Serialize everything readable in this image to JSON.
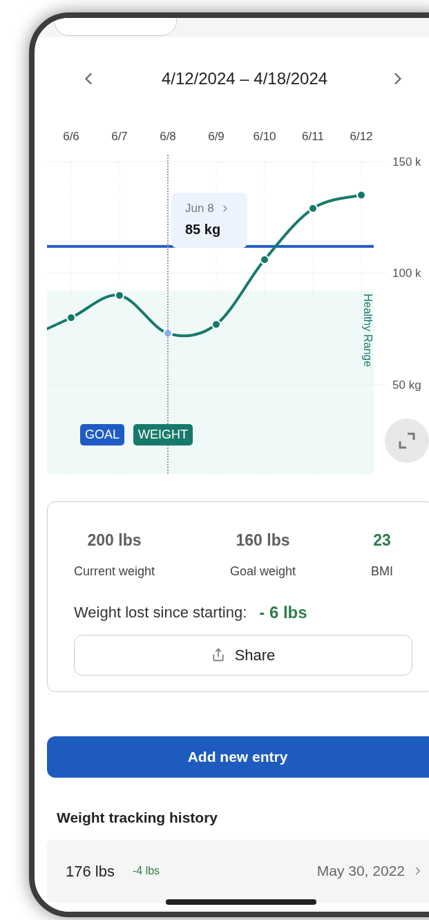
{
  "date_range": {
    "label": "4/12/2024 – 4/18/2024"
  },
  "chart": {
    "tooltip": {
      "date": "Jun 8",
      "value": "85 kg"
    },
    "chart_data": {
      "type": "line",
      "categories": [
        "6/6",
        "6/7",
        "6/8",
        "6/9",
        "6/10",
        "6/11",
        "6/12"
      ],
      "series": [
        {
          "name": "WEIGHT",
          "color": "#17796c",
          "marker": "o",
          "values": [
            80,
            90,
            73,
            77,
            106,
            129,
            135
          ]
        }
      ],
      "ref_lines": [
        {
          "axis": "y",
          "value": 112,
          "label": "GOAL",
          "color": "#1f5bc4"
        }
      ],
      "bands": [
        {
          "axis": "y",
          "from": 10,
          "to": 92,
          "label": "Healthy Range",
          "color": "#effaf8"
        }
      ],
      "grid": true,
      "ylim": [
        10,
        150
      ],
      "yticks": [
        {
          "value": 150,
          "label": "150 k"
        },
        {
          "value": 100,
          "label": "100 k"
        },
        {
          "value": 50,
          "label": "50 kg"
        }
      ],
      "annotations": [
        {
          "x": "6/8"
        }
      ]
    }
  },
  "stats": [
    {
      "value": "200 lbs",
      "label": "Current weight",
      "kind": "neutral"
    },
    {
      "value": "160 lbs",
      "label": "Goal weight",
      "kind": "neutral"
    },
    {
      "value": "23",
      "label": "BMI",
      "kind": "positive"
    }
  ],
  "summary": {
    "label": "Weight lost since starting:",
    "value": "- 6 lbs"
  },
  "share_button": {
    "label": "Share"
  },
  "add_button": {
    "label": "Add new entry"
  },
  "history": {
    "title": "Weight tracking history",
    "entries": [
      {
        "weight": "176 lbs",
        "change": "-4 lbs",
        "date": "May 30, 2022"
      }
    ]
  }
}
